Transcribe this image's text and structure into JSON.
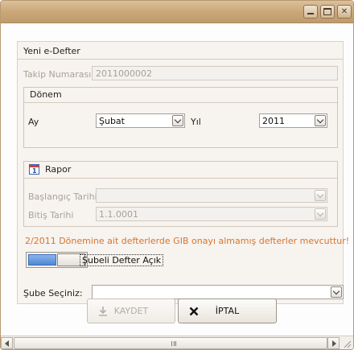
{
  "window": {
    "title": ""
  },
  "form": {
    "group_title": "Yeni e-Defter",
    "takip": {
      "label": "Takip Numarası",
      "value": "2011000002"
    },
    "donem": {
      "title": "Dönem",
      "ay_label": "Ay",
      "ay_value": "Şubat",
      "yil_label": "Yıl",
      "yil_value": "2011"
    },
    "rapor": {
      "title": "Rapor",
      "baslangic_label": "Başlangıç Tarihi",
      "baslangic_value": "",
      "bitis_label": "Bitiş Tarihi",
      "bitis_value": "1.1.0001"
    },
    "warning": "2/2011 Dönemine ait defterlerde GIB onayı almamış defterler mevcuttur!",
    "toggle_label": "Şubeli Defter Açık",
    "sube_label": "Şube Seçiniz:",
    "sube_value": ""
  },
  "buttons": {
    "save_label": "KAYDET",
    "cancel_label": "İPTAL"
  },
  "icons": {
    "minimize": "minimize-icon",
    "maximize": "maximize-icon",
    "close": "close-icon",
    "calendar": "calendar-icon",
    "save": "download-icon",
    "cancel": "x-icon"
  },
  "colors": {
    "warning": "#d9752b",
    "titlebar": "#c9a577",
    "toggle_on": "#4d86d6"
  }
}
